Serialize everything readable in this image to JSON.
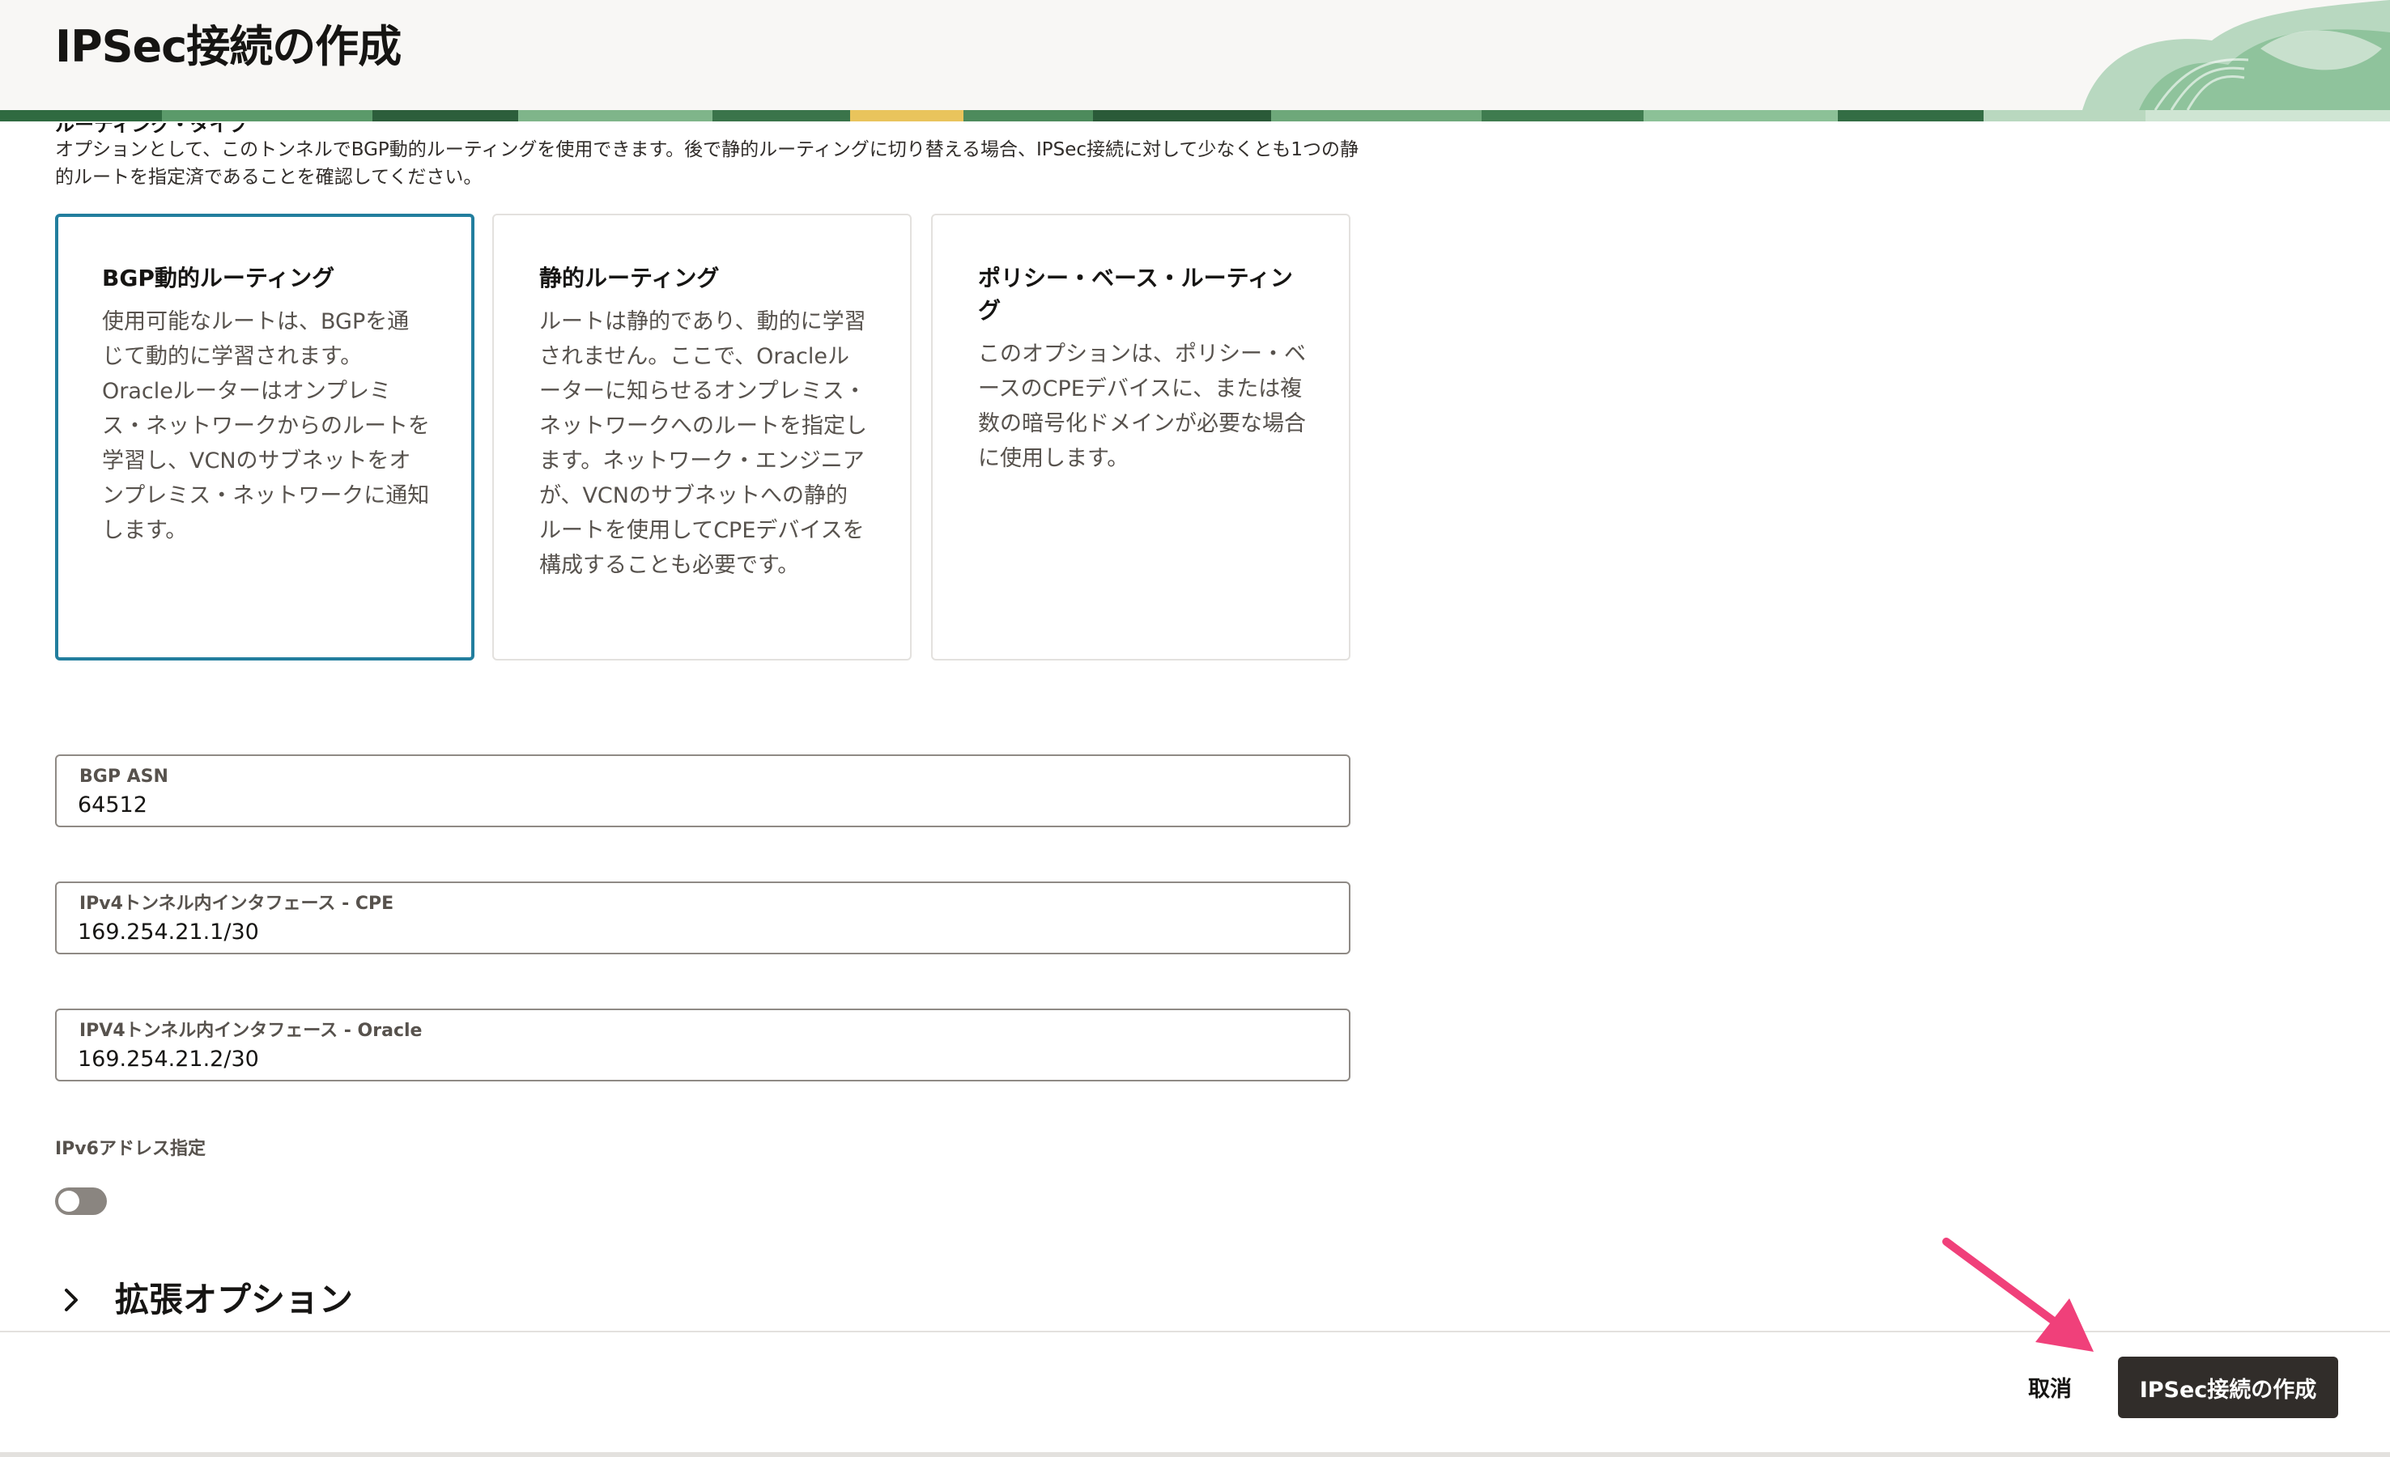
{
  "header": {
    "title": "IPSec接続の作成"
  },
  "routing": {
    "section_label": "ルーティング・タイプ",
    "description": "オプションとして、このトンネルでBGP動的ルーティングを使用できます。後で静的ルーティングに切り替える場合、IPSec接続に対して少なくとも1つの静的ルートを指定済であることを確認してください。",
    "options": [
      {
        "title": "BGP動的ルーティング",
        "description": "使用可能なルートは、BGPを通じて動的に学習されます。Oracleルーターはオンプレミス・ネットワークからのルートを学習し、VCNのサブネットをオンプレミス・ネットワークに通知します。",
        "selected": true
      },
      {
        "title": "静的ルーティング",
        "description": "ルートは静的であり、動的に学習されません。ここで、Oracleルーターに知らせるオンプレミス・ネットワークへのルートを指定します。ネットワーク・エンジニアが、VCNのサブネットへの静的ルートを使用してCPEデバイスを構成することも必要です。",
        "selected": false
      },
      {
        "title": "ポリシー・ベース・ルーティング",
        "description": "このオプションは、ポリシー・ベースのCPEデバイスに、または複数の暗号化ドメインが必要な場合に使用します。",
        "selected": false
      }
    ]
  },
  "fields": {
    "bgp_asn": {
      "label": "BGP ASN",
      "value": "64512"
    },
    "ipv4_cpe": {
      "label": "IPv4トンネル内インタフェース - CPE",
      "value": "169.254.21.1/30"
    },
    "ipv4_oracle": {
      "label": "IPV4トンネル内インタフェース - Oracle",
      "value": "169.254.21.2/30"
    }
  },
  "ipv6": {
    "label": "IPv6アドレス指定",
    "enabled": false
  },
  "advanced": {
    "label": "拡張オプション",
    "icon": "chevron-right-icon"
  },
  "footer": {
    "cancel_label": "取消",
    "submit_label": "IPSec接続の作成"
  },
  "colors": {
    "accent": "#227e9e",
    "primary_button": "#312d2a",
    "annotation_arrow": "#f0407a"
  }
}
